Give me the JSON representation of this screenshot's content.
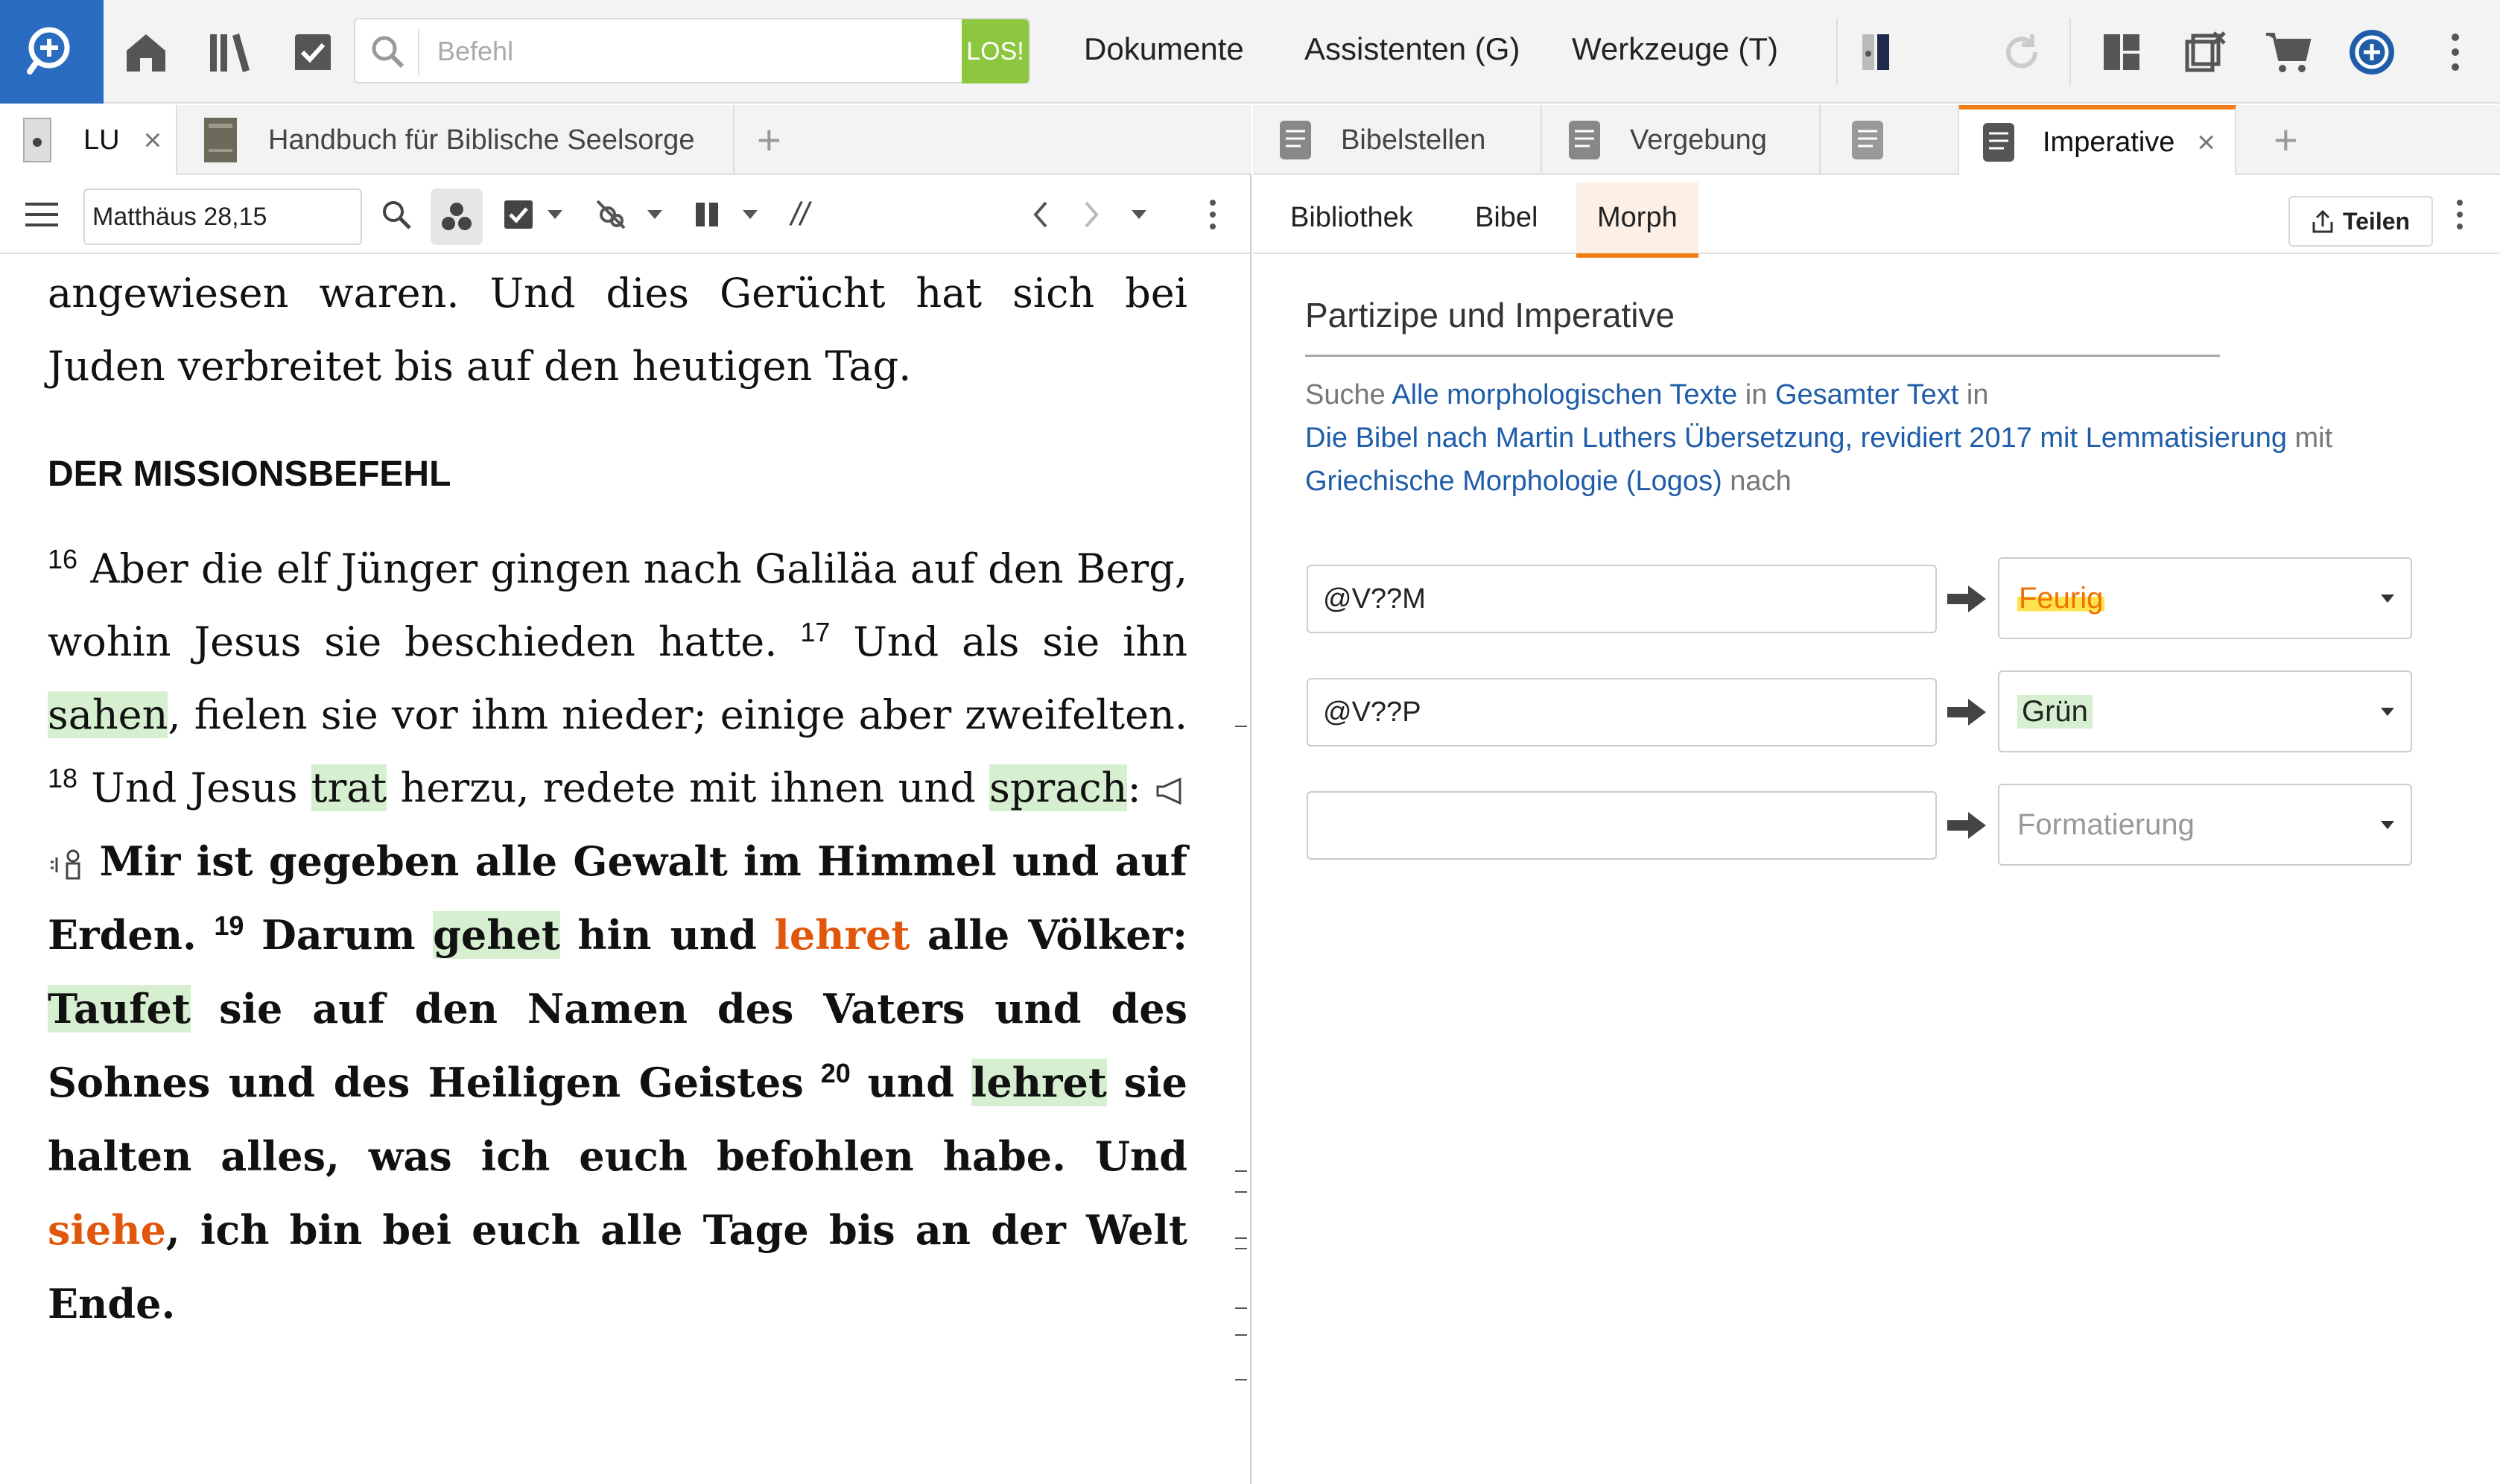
{
  "topbar": {
    "search_placeholder": "Befehl",
    "go_label": "LOS!",
    "menu": [
      "Dokumente",
      "Assistenten (G)",
      "Werkzeuge (T)"
    ]
  },
  "left": {
    "tabs": [
      {
        "label": "LU",
        "close": "×"
      },
      {
        "label": "Handbuch für Biblische Seelsorge"
      }
    ],
    "add_tab": "+",
    "reference": "Matthäus 28,15",
    "parallel": "//",
    "reader": {
      "p1": "angewiesen waren. Und dies Gerücht hat sich bei Juden verbreitet bis auf den heutigen Tag.",
      "heading": "DER MISSIONSBEFEHL",
      "v16": "16",
      "t16": "Aber die elf Jünger gingen nach Galiläa auf den Berg, wohin Jesus sie beschieden hatte.",
      "v17": "17",
      "t17a": "Und als sie ihn",
      "w_sahen": "sahen",
      "t17b": ", fielen sie vor ihm nieder; einige aber zweifelten.",
      "v18": "18",
      "t18a": "Und Jesus",
      "w_trat": "trat",
      "t18b": "herzu, redete mit ihnen und",
      "w_sprach": "sprach",
      "t18c": ":",
      "t18d": "Mir ist gegeben alle Gewalt im Himmel und auf Erden.",
      "v19": "19",
      "t19a": "Darum",
      "w_gehet": "gehet",
      "t19b": "hin und",
      "w_lehret1": "lehret",
      "t19c": "alle Völker:",
      "w_taufet": "Taufet",
      "t19d": "sie auf den Namen des Vaters und des Sohnes und des Heiligen Geistes",
      "v20": "20",
      "t20a": "und",
      "w_lehret2": "lehret",
      "t20b": "sie halten alles, was ich euch befohlen habe. Und",
      "w_siehe": "siehe",
      "t20c": ", ich bin bei euch alle Tage bis an der Welt Ende."
    }
  },
  "right": {
    "tabs": [
      {
        "label": "Bibelstellen"
      },
      {
        "label": "Vergebung"
      },
      {
        "label": ""
      },
      {
        "label": "Imperative",
        "close": "×"
      }
    ],
    "add_tab": "+",
    "subtabs": [
      "Bibliothek",
      "Bibel",
      "Morph"
    ],
    "share_label": "Teilen",
    "title": "Partizipe und Imperative",
    "desc": {
      "w1": "Suche",
      "l1": "Alle morphologischen Texte",
      "w2": "in",
      "l2": "Gesamter Text",
      "w3": "in",
      "l3": "Die Bibel nach Martin Luthers Übersetzung, revidiert 2017 mit Lemmatisierung",
      "w4": "mit",
      "l4": "Griechische Morphologie (Logos)",
      "w5": "nach"
    },
    "rules": [
      {
        "query": "@V??M",
        "format": "Feurig"
      },
      {
        "query": "@V??P",
        "format": "Grün"
      },
      {
        "query": "",
        "format_placeholder": "Formatierung"
      }
    ]
  },
  "colors": {
    "accent": "#f07f1a",
    "logo": "#2a6cc0",
    "go_button": "#8dc63f",
    "highlight_green": "#d6efd0",
    "imperative_orange": "#e0560b",
    "link": "#1f5da8"
  }
}
